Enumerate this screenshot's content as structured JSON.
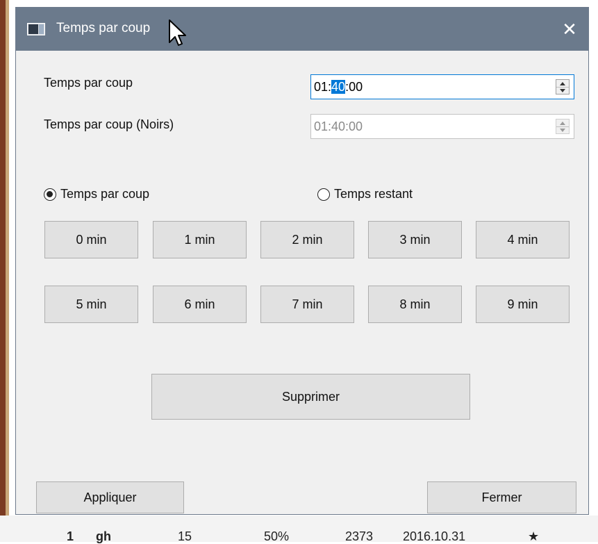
{
  "dialog": {
    "title": "Temps par coup",
    "close_glyph": "✕",
    "title_icon": "app-window-icon",
    "close_icon": "close-icon"
  },
  "fields": {
    "white_label": "Temps par coup",
    "white_value_pre": "01:",
    "white_value_sel": "40",
    "white_value_post": ":00",
    "black_label": "Temps par coup (Noirs)",
    "black_value": "01:40:00"
  },
  "radios": {
    "per_move": "Temps par coup",
    "remaining": "Temps restant",
    "selected": "per_move"
  },
  "presets": [
    "0 min",
    "1 min",
    "2 min",
    "3 min",
    "4 min",
    "5 min",
    "6 min",
    "7 min",
    "8 min",
    "9 min"
  ],
  "actions": {
    "delete": "Supprimer",
    "apply": "Appliquer",
    "close": "Fermer"
  },
  "background_row": {
    "c1": "1",
    "c2": "gh",
    "c3": "15",
    "c4": "50%",
    "c5": "2373",
    "c6": "2016.10.31",
    "c7": "★"
  },
  "colors": {
    "titlebar": "#6b7a8c",
    "selection": "#0078d7",
    "button_face": "#e1e1e1",
    "dialog_bg": "#f0f0f0"
  }
}
